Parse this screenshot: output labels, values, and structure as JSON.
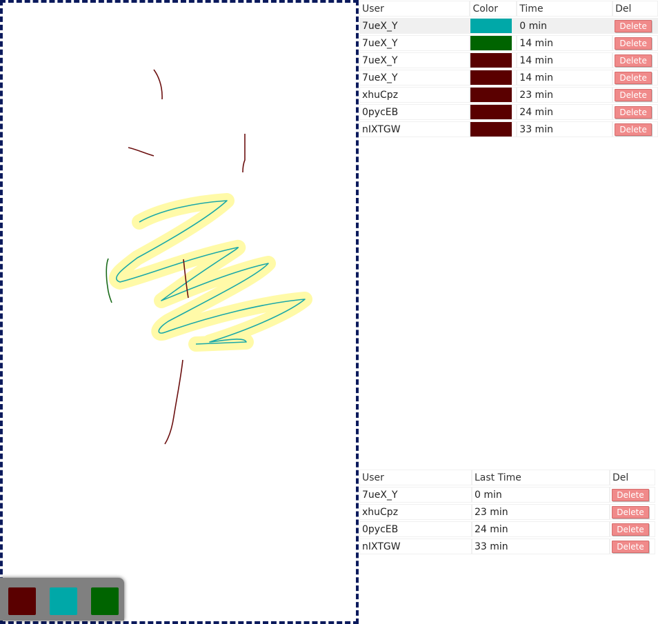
{
  "palette": [
    {
      "name": "dark-red",
      "color": "#5a0000"
    },
    {
      "name": "teal",
      "color": "#00a8a8"
    },
    {
      "name": "green",
      "color": "#006400"
    }
  ],
  "strokes_table": {
    "headers": {
      "user": "User",
      "color": "Color",
      "time": "Time",
      "del": "Del"
    },
    "rows": [
      {
        "user": "7ueX_Y",
        "color": "#00a8a8",
        "time": "0 min",
        "del": "Delete"
      },
      {
        "user": "7ueX_Y",
        "color": "#006400",
        "time": "14 min",
        "del": "Delete"
      },
      {
        "user": "7ueX_Y",
        "color": "#5a0000",
        "time": "14 min",
        "del": "Delete"
      },
      {
        "user": "7ueX_Y",
        "color": "#5a0000",
        "time": "14 min",
        "del": "Delete"
      },
      {
        "user": "xhuCpz",
        "color": "#5a0000",
        "time": "23 min",
        "del": "Delete"
      },
      {
        "user": "0pycEB",
        "color": "#5a0000",
        "time": "24 min",
        "del": "Delete"
      },
      {
        "user": "nIXTGW",
        "color": "#5a0000",
        "time": "33 min",
        "del": "Delete"
      }
    ]
  },
  "users_table": {
    "headers": {
      "user": "User",
      "last": "Last Time",
      "del": "Del"
    },
    "rows": [
      {
        "user": "7ueX_Y",
        "last": "0 min",
        "del": "Delete"
      },
      {
        "user": "xhuCpz",
        "last": "23 min",
        "del": "Delete"
      },
      {
        "user": "0pycEB",
        "last": "24 min",
        "del": "Delete"
      },
      {
        "user": "nIXTGW",
        "last": "33 min",
        "del": "Delete"
      }
    ]
  },
  "colors": {
    "canvas_border": "#0b1a5c",
    "highlight": "#fffaa8",
    "delete_button": "#f08a8a"
  }
}
